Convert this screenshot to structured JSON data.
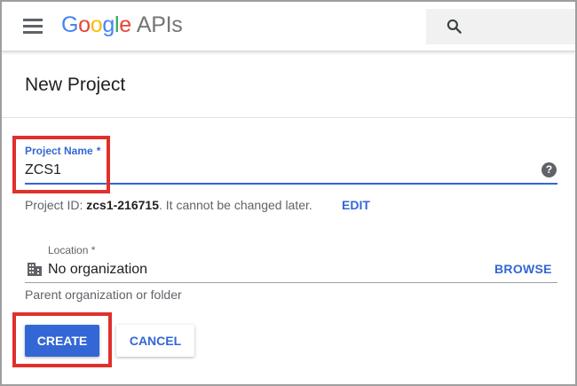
{
  "topbar": {
    "logo": {
      "letters": [
        "G",
        "o",
        "o",
        "g",
        "l",
        "e"
      ],
      "product": "APIs"
    },
    "menu_icon": "hamburger-menu-icon",
    "search_icon": "search-icon"
  },
  "page": {
    "title": "New Project"
  },
  "project_name": {
    "label": "Project Name",
    "required_mark": "*",
    "value": "ZCS1",
    "help_icon": "?"
  },
  "project_id": {
    "prefix": "Project ID: ",
    "id": "zcs1-216715",
    "suffix": ". It cannot be changed later.",
    "edit_label": "EDIT"
  },
  "location": {
    "label": "Location *",
    "value": "No organization",
    "browse_label": "BROWSE",
    "helper": "Parent organization or folder",
    "icon": "building-icon"
  },
  "actions": {
    "create_label": "CREATE",
    "cancel_label": "CANCEL"
  },
  "colors": {
    "accent": "#3367d6",
    "highlight": "#e0302b"
  }
}
